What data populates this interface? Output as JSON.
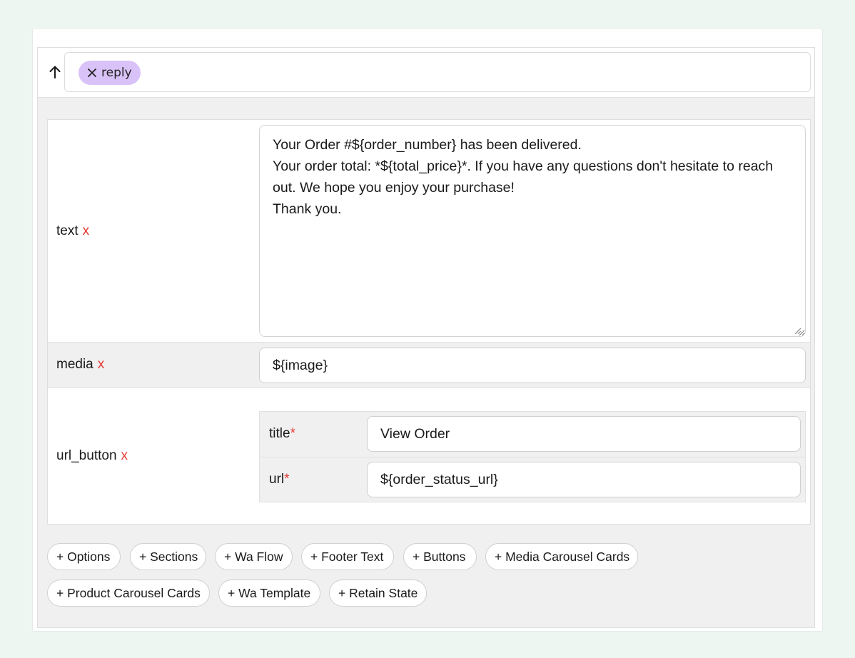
{
  "reply_chip": {
    "label": "reply"
  },
  "fields": {
    "text": {
      "label": "text",
      "remove_label": "x",
      "value": "Your Order #${order_number} has been delivered.\nYour order total: *${total_price}*. If you have any questions don't hesitate to reach out. We hope you enjoy your purchase!\nThank you."
    },
    "media": {
      "label": "media",
      "remove_label": "x",
      "value": "${image}"
    },
    "url_button": {
      "label": "url_button",
      "remove_label": "x",
      "title": {
        "label": "title",
        "required_mark": "*",
        "value": "View Order"
      },
      "url": {
        "label": "url",
        "required_mark": "*",
        "value": "${order_status_url}"
      }
    }
  },
  "add_buttons": [
    "+ Options",
    "+ Sections",
    "+ Wa Flow",
    "+ Footer Text",
    "+ Buttons",
    "+ Media Carousel Cards",
    "+ Product Carousel Cards",
    "+ Wa Template",
    "+ Retain State"
  ],
  "colors": {
    "chip_bg": "#d9c2f7",
    "remove_red": "#e53935",
    "page_bg": "#eef6f1"
  }
}
